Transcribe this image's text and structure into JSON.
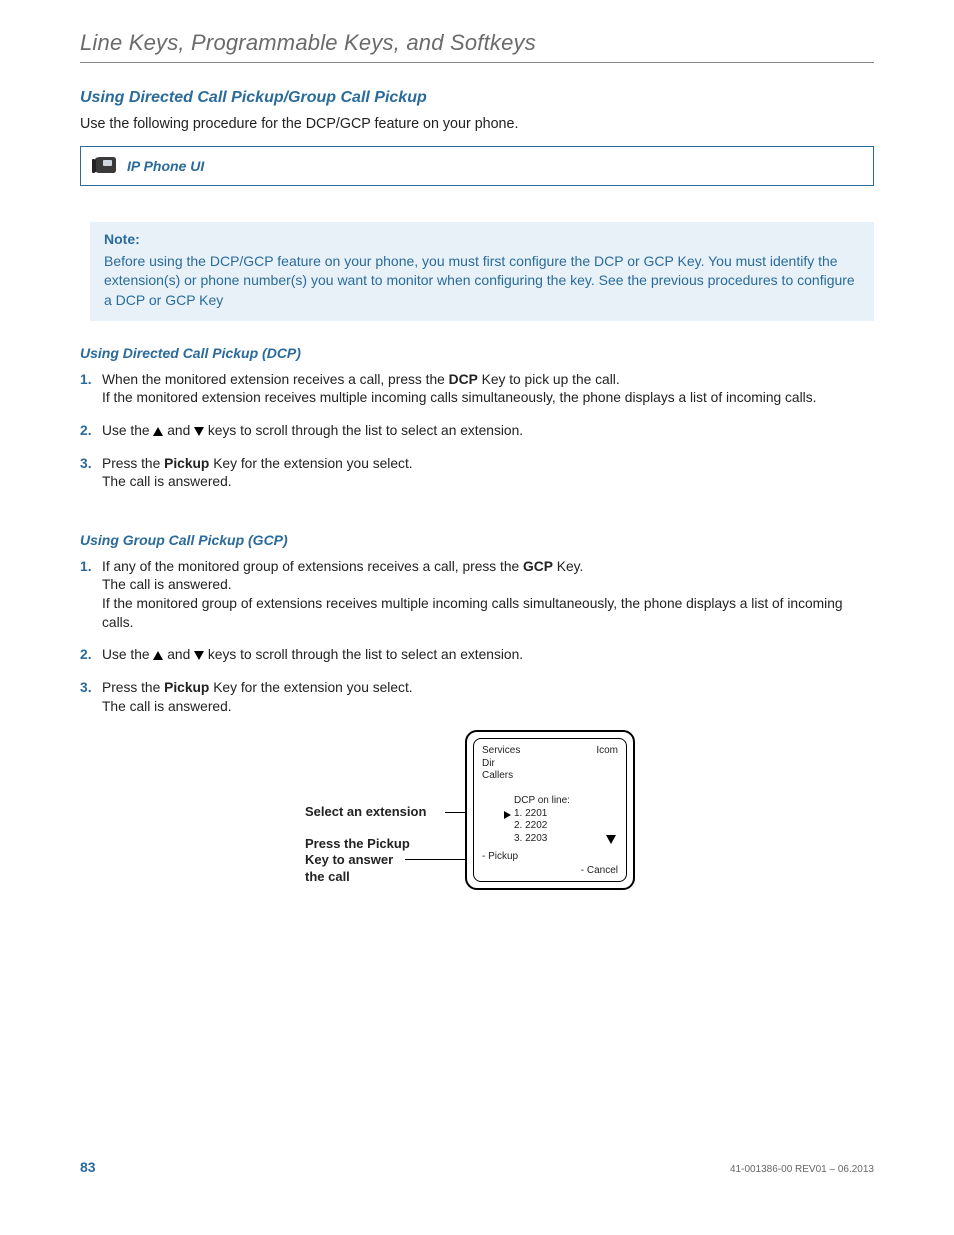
{
  "breadcrumb": "Line Keys, Programmable Keys, and Softkeys",
  "section_heading": "Using Directed Call Pickup/Group Call Pickup",
  "intro_text": "Use the following procedure for the DCP/GCP feature on your phone.",
  "ui_box_label": "IP Phone UI",
  "note": {
    "title": "Note:",
    "body": "Before using the DCP/GCP feature on your phone, you must first configure the DCP or GCP Key. You must identify the extension(s) or phone number(s) you want to monitor when configuring the key. See the previous procedures to configure a DCP or GCP Key"
  },
  "dcp": {
    "heading": "Using Directed Call Pickup (DCP)",
    "steps": [
      {
        "line1_pre": "When the monitored extension receives a call, press the ",
        "line1_bold": "DCP",
        "line1_post": " Key to pick up the call.",
        "line2": "If the monitored extension receives multiple incoming calls simultaneously, the phone displays a list of incoming calls."
      },
      {
        "line1_pre": "Use the ",
        "line1_mid": " and ",
        "line1_post": " keys to scroll through the list to select an extension."
      },
      {
        "line1_pre": "Press the ",
        "line1_bold": "Pickup",
        "line1_post": " Key for the extension you select.",
        "line2": "The call is answered."
      }
    ]
  },
  "gcp": {
    "heading": "Using Group Call Pickup (GCP)",
    "steps": [
      {
        "line1_pre": "If any of the monitored group of extensions receives a call, press the ",
        "line1_bold": "GCP",
        "line1_post": " Key.",
        "line2": "The call is answered.",
        "line3": "If the monitored group of extensions receives multiple incoming calls simultaneously, the phone displays a list of incoming calls."
      },
      {
        "line1_pre": "Use the ",
        "line1_mid": " and ",
        "line1_post": " keys to scroll through the list to select an extension."
      },
      {
        "line1_pre": "Press the ",
        "line1_bold": "Pickup",
        "line1_post": " Key for the extension you select.",
        "line2": "The call is answered."
      }
    ]
  },
  "diagram": {
    "label_select": "Select an extension",
    "label_pickup_l1": "Press the Pickup",
    "label_pickup_l2": "Key to answer",
    "label_pickup_l3": "the call",
    "screen": {
      "top_left": [
        "Services",
        "Dir",
        "Callers"
      ],
      "top_right": "Icom",
      "list_title": "DCP on line:",
      "list_items": [
        "1. 2201",
        "2. 2202",
        "3. 2203"
      ],
      "bottom_left": "- Pickup",
      "bottom_right": "- Cancel"
    }
  },
  "footer": {
    "page_number": "83",
    "doc_rev": "41-001386-00 REV01 – 06.2013"
  }
}
